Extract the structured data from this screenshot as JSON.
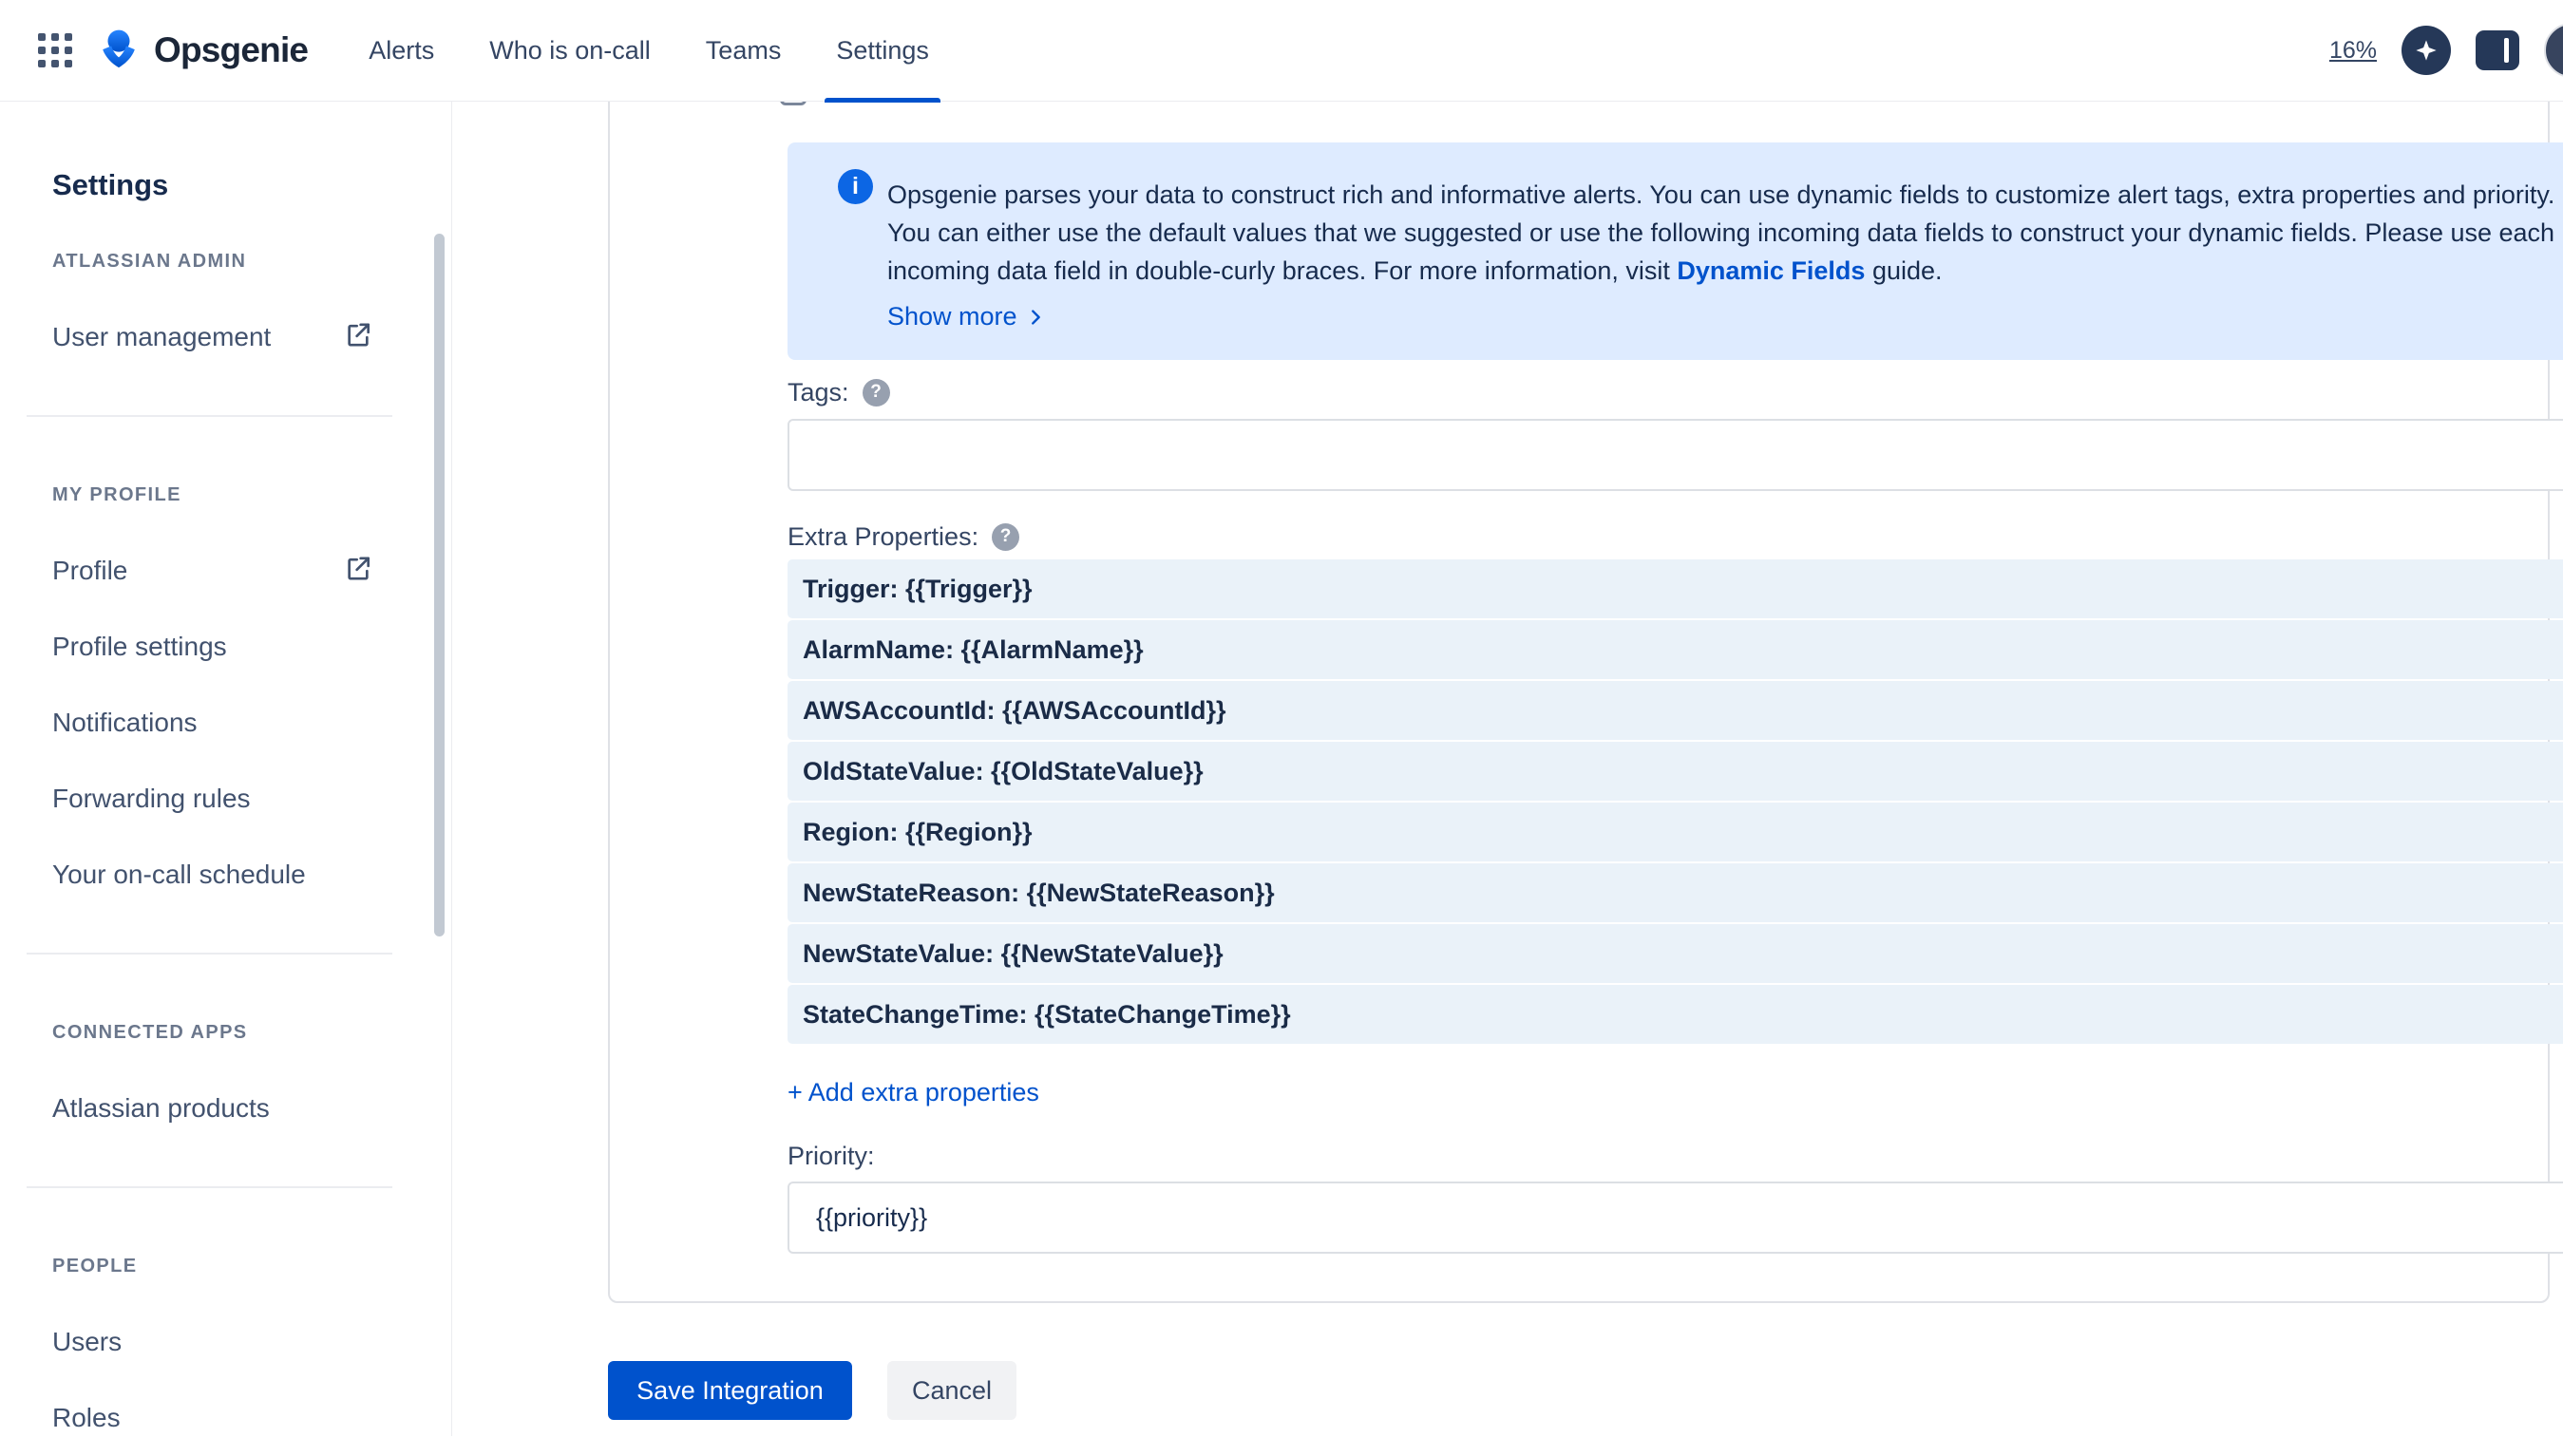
{
  "topbar": {
    "brand": "Opsgenie",
    "nav": [
      {
        "label": "Alerts"
      },
      {
        "label": "Who is on-call"
      },
      {
        "label": "Teams"
      },
      {
        "label": "Settings"
      }
    ],
    "trial": "16%"
  },
  "sidebar": {
    "title": "Settings",
    "sections": [
      {
        "label": "ATLASSIAN ADMIN",
        "items": [
          {
            "label": "User management"
          }
        ]
      },
      {
        "label": "MY PROFILE",
        "items": [
          {
            "label": "Profile"
          },
          {
            "label": "Profile settings"
          },
          {
            "label": "Notifications"
          },
          {
            "label": "Forwarding rules"
          },
          {
            "label": "Your on-call schedule"
          }
        ]
      },
      {
        "label": "CONNECTED APPS",
        "items": [
          {
            "label": "Atlassian products"
          }
        ]
      },
      {
        "label": "PEOPLE",
        "items": [
          {
            "label": "Users"
          },
          {
            "label": "Roles"
          }
        ]
      }
    ]
  },
  "form": {
    "info": {
      "body": "Opsgenie parses your data to construct rich and informative alerts. You can use dynamic fields to customize alert tags, extra properties and priority. You can either use the default values that we suggested or use the following incoming data fields to construct your dynamic fields. Please use each incoming data field in double-curly braces. For more information, visit",
      "link": "Dynamic Fields",
      "suffix": "guide.",
      "show_more": "Show more"
    },
    "tags": {
      "label": "Tags:",
      "value": ""
    },
    "extra_properties": {
      "label": "Extra Properties:",
      "rows": [
        "Trigger: {{Trigger}}",
        "AlarmName: {{AlarmName}}",
        "AWSAccountId: {{AWSAccountId}}",
        "OldStateValue: {{OldStateValue}}",
        "Region: {{Region}}",
        "NewStateReason: {{NewStateReason}}",
        "NewStateValue: {{NewStateValue}}",
        "StateChangeTime: {{StateChangeTime}}"
      ],
      "add_label": "+ Add extra properties"
    },
    "priority": {
      "label": "Priority:",
      "value": "{{priority}}"
    },
    "buttons": {
      "save": "Save Integration",
      "cancel": "Cancel"
    }
  },
  "icons": {
    "help": "?",
    "info": "i",
    "close": "✕"
  },
  "colors": {
    "accent": "#0052CC",
    "info_bg": "#DEEBFF",
    "row_bg": "#EAF2F9",
    "navy": "#172B4D"
  }
}
